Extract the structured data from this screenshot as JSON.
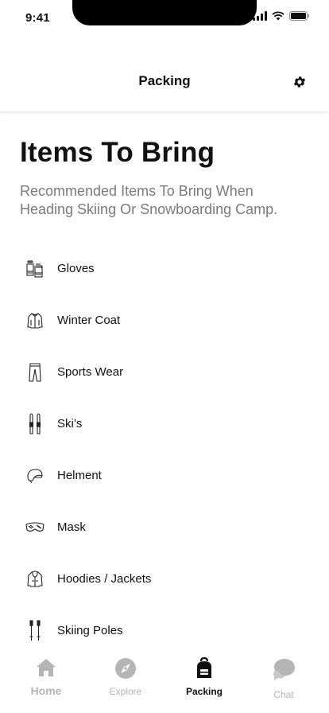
{
  "status_bar": {
    "time": "9:41"
  },
  "header": {
    "title": "Packing"
  },
  "page": {
    "title": "Items To Bring",
    "subtitle": "Recommended Items To Bring When Heading Skiing Or Snowboarding Camp."
  },
  "items": [
    {
      "label": "Gloves",
      "icon": "gloves-icon"
    },
    {
      "label": "Winter Coat",
      "icon": "coat-icon"
    },
    {
      "label": "Sports Wear",
      "icon": "pants-icon"
    },
    {
      "label": "Ski’s",
      "icon": "skis-icon"
    },
    {
      "label": "Helment",
      "icon": "helmet-icon"
    },
    {
      "label": "Mask",
      "icon": "goggles-icon"
    },
    {
      "label": "Hoodies / Jackets",
      "icon": "hoodie-icon"
    },
    {
      "label": "Skiing Poles",
      "icon": "poles-icon"
    }
  ],
  "tabs": [
    {
      "label": "Home",
      "icon": "home-icon",
      "active": false
    },
    {
      "label": "Explore",
      "icon": "compass-icon",
      "active": false
    },
    {
      "label": "Packing",
      "icon": "backpack-icon",
      "active": true
    },
    {
      "label": "Chat",
      "icon": "chat-icon",
      "active": false
    }
  ],
  "colors": {
    "active": "#111111",
    "inactive": "#b5b5b5",
    "subtitle": "#7b7b7b"
  }
}
